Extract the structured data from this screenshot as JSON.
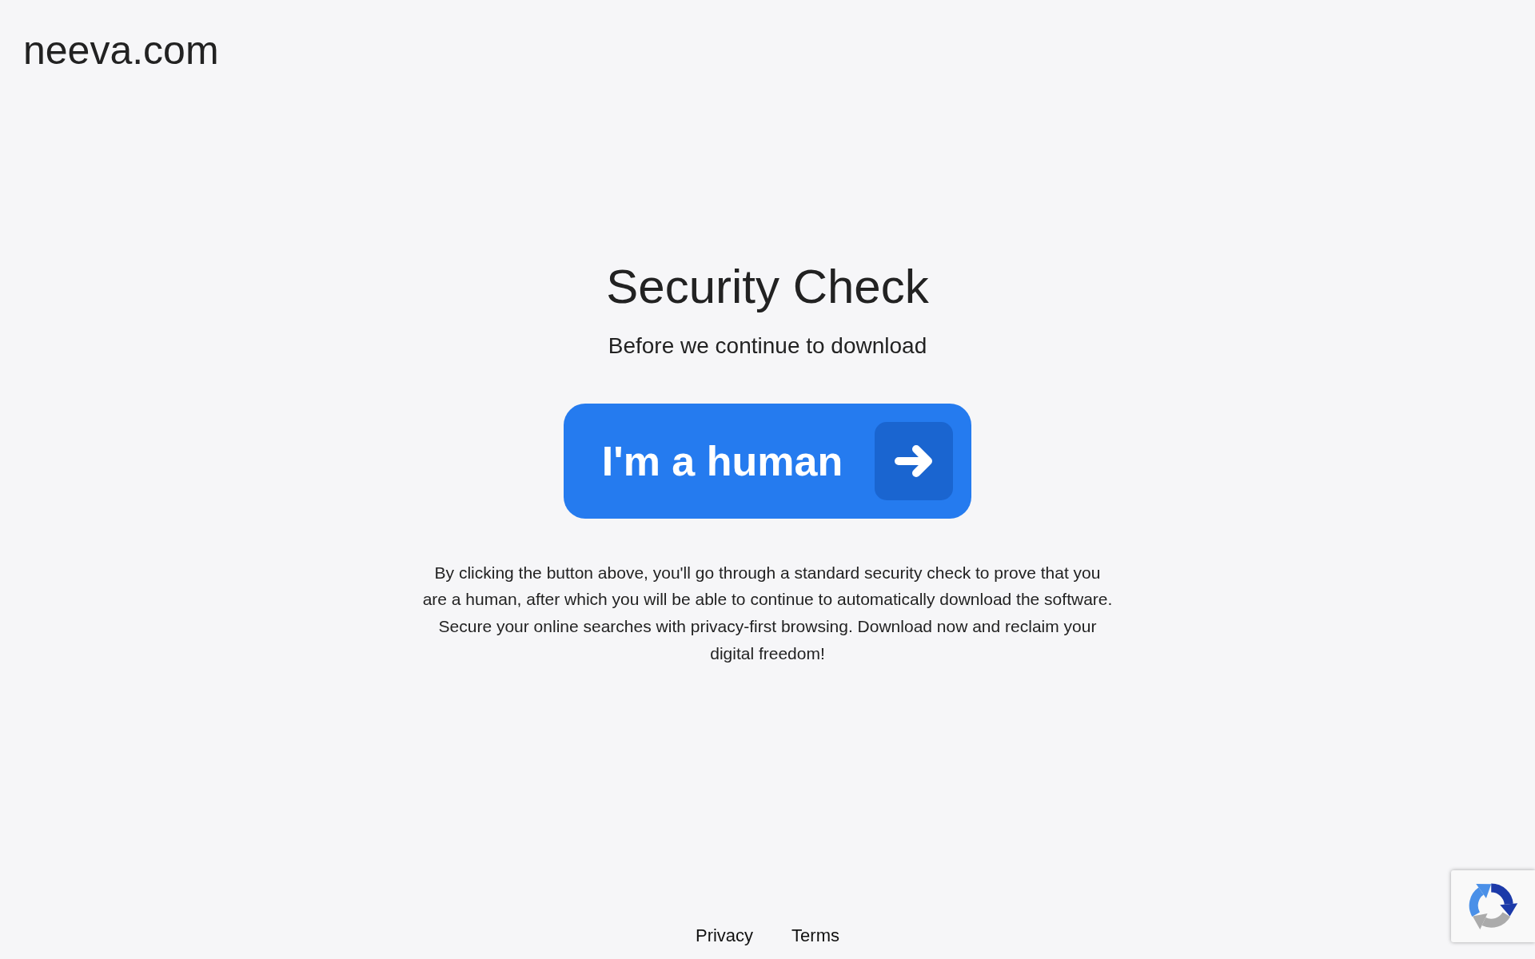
{
  "header": {
    "site_name": "neeva.com"
  },
  "main": {
    "title": "Security Check",
    "subtitle": "Before we continue to download",
    "button": {
      "label": "I'm a human"
    },
    "description": "By clicking the button above, you'll go through a standard security check to prove that you are a human, after which you will be able to continue to automatically download the software. Secure your online searches with privacy-first browsing. Download now and reclaim your digital freedom!"
  },
  "footer": {
    "links": [
      "Privacy",
      "Terms"
    ]
  }
}
